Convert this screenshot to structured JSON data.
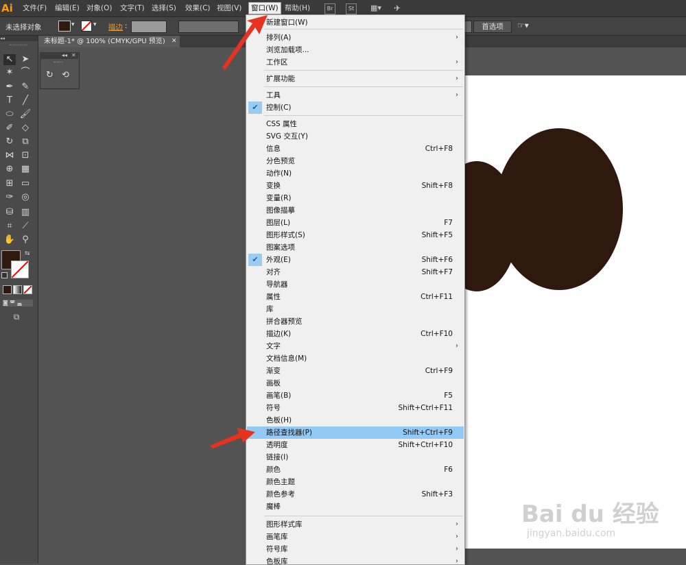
{
  "app": {
    "logo": "Ai"
  },
  "menubar": {
    "items": [
      "文件(F)",
      "编辑(E)",
      "对象(O)",
      "文字(T)",
      "选择(S)",
      "效果(C)",
      "视图(V)",
      "窗口(W)",
      "帮助(H)"
    ],
    "icons": [
      "Br",
      "St"
    ]
  },
  "controlbar": {
    "selection_label": "未选择对象",
    "stroke_label": "描边",
    "preferences_button": "首选项"
  },
  "document": {
    "tab_label": "未标题-1* @ 100% (CMYK/GPU 预览)"
  },
  "window_menu": {
    "items": [
      {
        "label": "新建窗口(W)",
        "shortcut": "",
        "submenu": false,
        "checked": false
      },
      {
        "label": "排列(A)",
        "shortcut": "",
        "submenu": true,
        "checked": false
      },
      {
        "label": "浏览加载项...",
        "shortcut": "",
        "submenu": false,
        "checked": false
      },
      {
        "label": "工作区",
        "shortcut": "",
        "submenu": true,
        "checked": false
      },
      {
        "label": "扩展功能",
        "shortcut": "",
        "submenu": true,
        "checked": false
      },
      {
        "label": "工具",
        "shortcut": "",
        "submenu": true,
        "checked": false
      },
      {
        "label": "控制(C)",
        "shortcut": "",
        "submenu": false,
        "checked": true
      },
      {
        "label": "CSS 属性",
        "shortcut": "",
        "submenu": false,
        "checked": false
      },
      {
        "label": "SVG 交互(Y)",
        "shortcut": "",
        "submenu": false,
        "checked": false
      },
      {
        "label": "信息",
        "shortcut": "Ctrl+F8",
        "submenu": false,
        "checked": false
      },
      {
        "label": "分色预览",
        "shortcut": "",
        "submenu": false,
        "checked": false
      },
      {
        "label": "动作(N)",
        "shortcut": "",
        "submenu": false,
        "checked": false
      },
      {
        "label": "变换",
        "shortcut": "Shift+F8",
        "submenu": false,
        "checked": false
      },
      {
        "label": "变量(R)",
        "shortcut": "",
        "submenu": false,
        "checked": false
      },
      {
        "label": "图像描摹",
        "shortcut": "",
        "submenu": false,
        "checked": false
      },
      {
        "label": "图层(L)",
        "shortcut": "F7",
        "submenu": false,
        "checked": false
      },
      {
        "label": "图形样式(S)",
        "shortcut": "Shift+F5",
        "submenu": false,
        "checked": false
      },
      {
        "label": "图案选项",
        "shortcut": "",
        "submenu": false,
        "checked": false
      },
      {
        "label": "外观(E)",
        "shortcut": "Shift+F6",
        "submenu": false,
        "checked": true
      },
      {
        "label": "对齐",
        "shortcut": "Shift+F7",
        "submenu": false,
        "checked": false
      },
      {
        "label": "导航器",
        "shortcut": "",
        "submenu": false,
        "checked": false
      },
      {
        "label": "属性",
        "shortcut": "Ctrl+F11",
        "submenu": false,
        "checked": false
      },
      {
        "label": "库",
        "shortcut": "",
        "submenu": false,
        "checked": false
      },
      {
        "label": "拼合器预览",
        "shortcut": "",
        "submenu": false,
        "checked": false
      },
      {
        "label": "描边(K)",
        "shortcut": "Ctrl+F10",
        "submenu": false,
        "checked": false
      },
      {
        "label": "文字",
        "shortcut": "",
        "submenu": true,
        "checked": false
      },
      {
        "label": "文档信息(M)",
        "shortcut": "",
        "submenu": false,
        "checked": false
      },
      {
        "label": "渐变",
        "shortcut": "Ctrl+F9",
        "submenu": false,
        "checked": false
      },
      {
        "label": "画板",
        "shortcut": "",
        "submenu": false,
        "checked": false
      },
      {
        "label": "画笔(B)",
        "shortcut": "F5",
        "submenu": false,
        "checked": false
      },
      {
        "label": "符号",
        "shortcut": "Shift+Ctrl+F11",
        "submenu": false,
        "checked": false
      },
      {
        "label": "色板(H)",
        "shortcut": "",
        "submenu": false,
        "checked": false
      },
      {
        "label": "路径查找器(P)",
        "shortcut": "Shift+Ctrl+F9",
        "submenu": false,
        "checked": false,
        "highlighted": true
      },
      {
        "label": "透明度",
        "shortcut": "Shift+Ctrl+F10",
        "submenu": false,
        "checked": false
      },
      {
        "label": "链接(I)",
        "shortcut": "",
        "submenu": false,
        "checked": false
      },
      {
        "label": "颜色",
        "shortcut": "F6",
        "submenu": false,
        "checked": false
      },
      {
        "label": "颜色主题",
        "shortcut": "",
        "submenu": false,
        "checked": false
      },
      {
        "label": "颜色参考",
        "shortcut": "Shift+F3",
        "submenu": false,
        "checked": false
      },
      {
        "label": "魔棒",
        "shortcut": "",
        "submenu": false,
        "checked": false
      },
      {
        "label": "图形样式库",
        "shortcut": "",
        "submenu": true,
        "checked": false
      },
      {
        "label": "画笔库",
        "shortcut": "",
        "submenu": true,
        "checked": false
      },
      {
        "label": "符号库",
        "shortcut": "",
        "submenu": true,
        "checked": false
      },
      {
        "label": "色板库",
        "shortcut": "",
        "submenu": true,
        "checked": false
      }
    ]
  },
  "watermark": {
    "brand": "Bai du 经验",
    "url": "jingyan.baidu.com"
  },
  "colors": {
    "shape_fill": "#2f190e",
    "menu_highlight": "#91c9f7",
    "annotation_arrow": "#e8321e",
    "logo": "#ff9a00"
  }
}
